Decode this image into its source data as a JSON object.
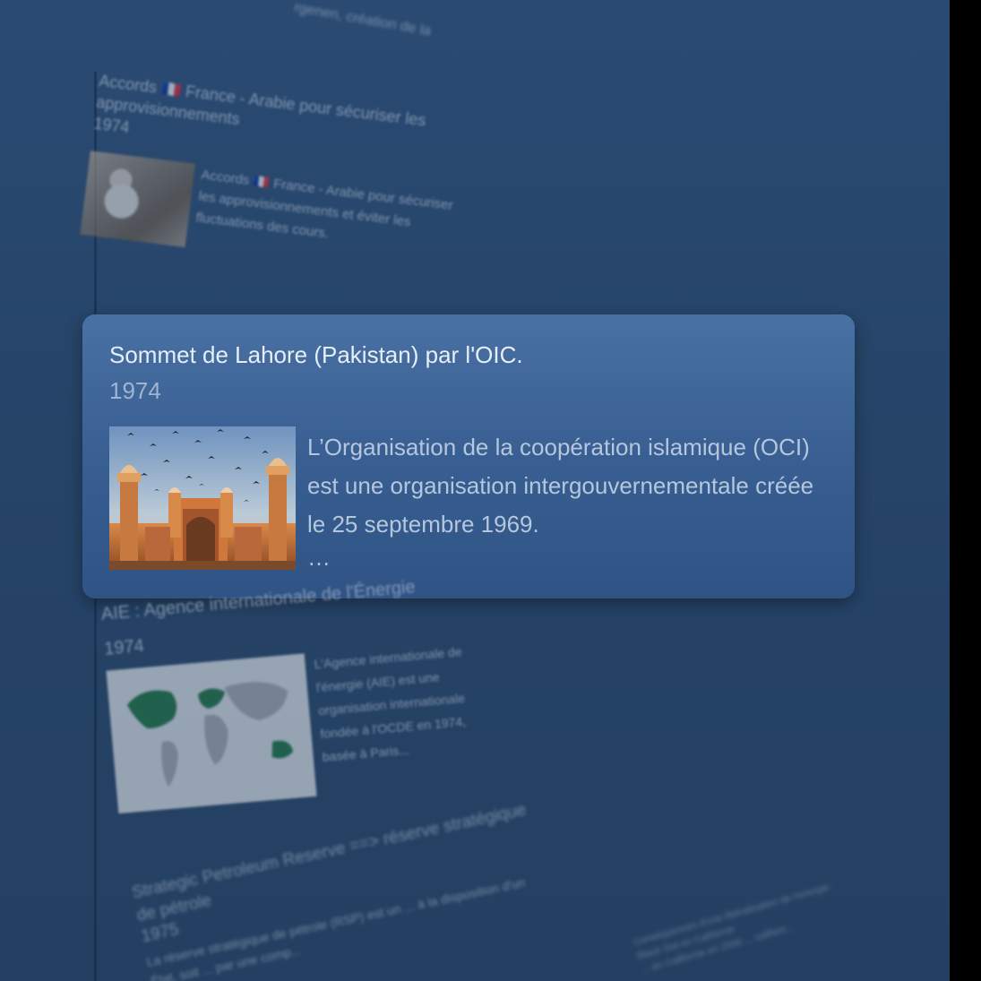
{
  "top_fragment": "rgenen, création de la",
  "events": {
    "accords": {
      "title": "Accords 🇫🇷 France - Arabie pour sécuriser les approvisionnements",
      "year": "1974",
      "description": "Accords 🇫🇷 France - Arabie pour sécuriser les approvisionnements et éviter les fluctuations des cours."
    },
    "lahore": {
      "title": "Sommet de Lahore (Pakistan) par l'OIC.",
      "year": "1974",
      "description": "L’Organisation de la coopération islamique (OCI) est une organisation intergouverne­mentale créée le 25 septembre 1969.",
      "more": "…"
    },
    "aie": {
      "title": "AIE : Agence internationale de l'Énergie",
      "year": "1974",
      "description": "L'Agence internationale de l'énergie (AIE) est une organisation internationale fondée à l'OCDE en 1974, basée à Paris..."
    },
    "spr": {
      "title": "Strategic Petroleum Reserve ==> réserve stratégique de pétrole",
      "year": "1975",
      "description": "La réserve stratégique de pétrole (RSP) est un ... à la disposition d'un État, soit ... par une comp..."
    },
    "california": {
      "title": "Conséquences d'une libéralisation de l'energie : Black Out en Californie",
      "description": "... en Californie en 2000 ... californ..."
    }
  },
  "colors": {
    "background": "#264468",
    "card": "#3a6094",
    "title_text": "#e6eef8",
    "year_text": "#9fb5d0",
    "desc_text": "#b5c7dd"
  }
}
